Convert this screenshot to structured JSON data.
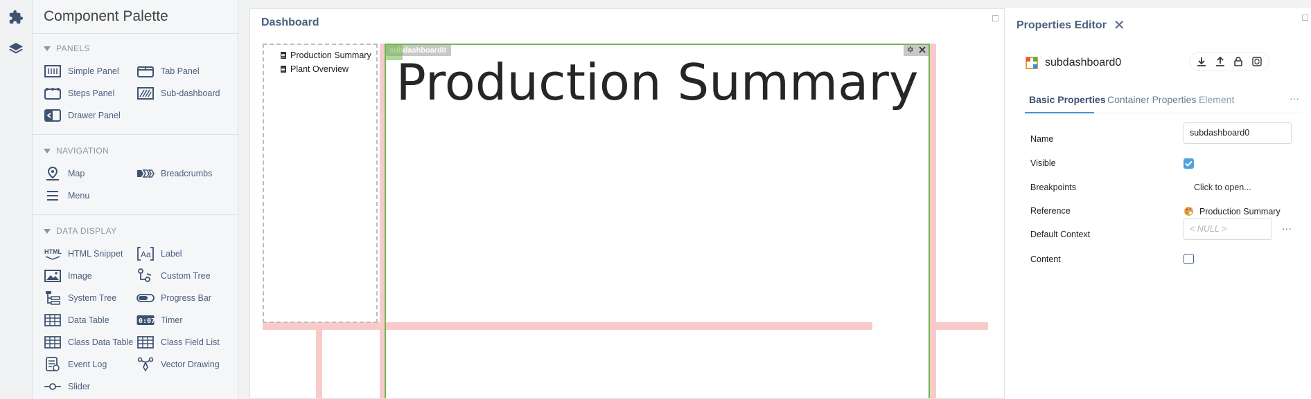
{
  "palette": {
    "title": "Component Palette",
    "sections": {
      "panels": {
        "label": "PANELS",
        "items": [
          "Simple Panel",
          "Tab Panel",
          "Steps Panel",
          "Sub-dashboard",
          "Drawer Panel"
        ]
      },
      "navigation": {
        "label": "NAVIGATION",
        "items": [
          "Map",
          "Breadcrumbs",
          "Menu"
        ]
      },
      "data_display": {
        "label": "DATA DISPLAY",
        "items": [
          "HTML Snippet",
          "Label",
          "Image",
          "Custom Tree",
          "System Tree",
          "Progress Bar",
          "Data Table",
          "Timer",
          "Class Data Table",
          "Class Field List",
          "Event Log",
          "Vector Drawing",
          "Slider"
        ]
      }
    }
  },
  "dashboard": {
    "title": "Dashboard",
    "nav_items": [
      "Production Summary",
      "Plant Overview"
    ],
    "subdashboard_tag": "subdashboard0",
    "content_title": "Production Summary"
  },
  "properties": {
    "title": "Properties Editor",
    "component_name": "subdashboard0",
    "tabs": [
      "Basic Properties",
      "Container Properties",
      "Element"
    ],
    "tab_more": "···",
    "labels": {
      "name": "Name",
      "visible": "Visible",
      "breakpoints": "Breakpoints",
      "reference": "Reference",
      "default_context": "Default Context",
      "content": "Content"
    },
    "values": {
      "name": "subdashboard0",
      "breakpoints": "Click to open...",
      "reference": "Production Summary",
      "default_context_placeholder": "< NULL >",
      "visible_checked": true,
      "content_checked": false
    },
    "more_dots": "···"
  },
  "colors": {
    "accent_green": "#6fb84a",
    "guide_red": "#f9caca",
    "link_blue": "#4a6080",
    "checkbox_blue": "#4fa3dd"
  }
}
